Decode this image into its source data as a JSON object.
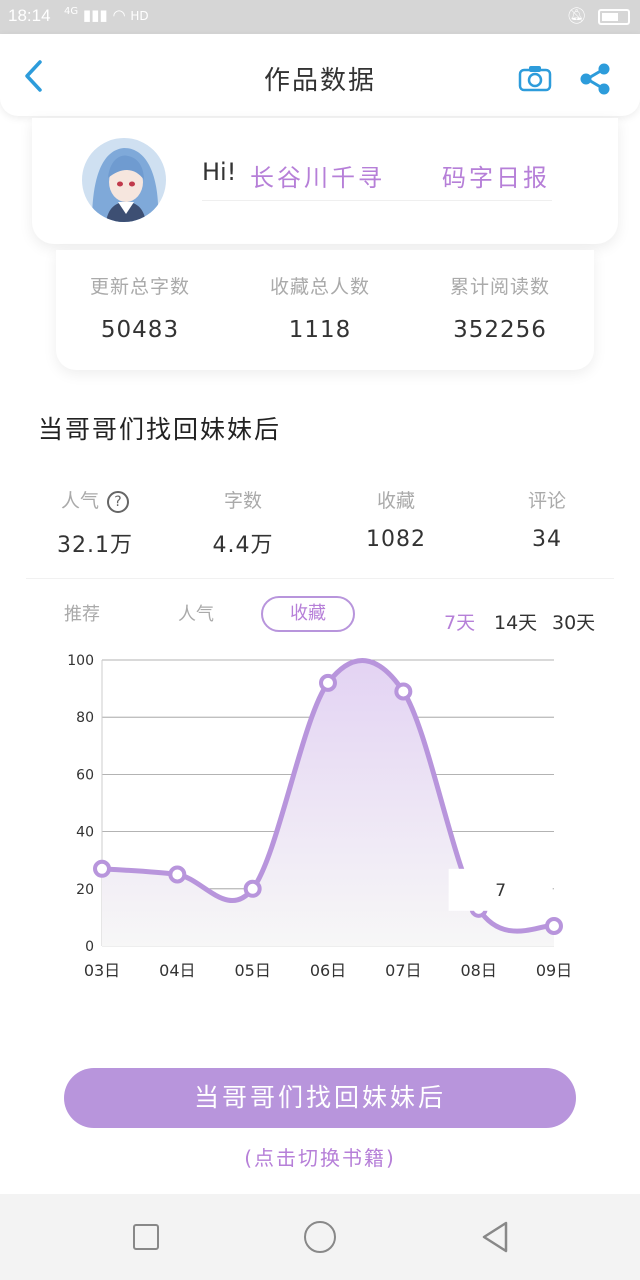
{
  "status_bar": {
    "time": "18:14",
    "network": "4G",
    "hd": "HD"
  },
  "header": {
    "title": "作品数据",
    "back_icon": "back-chevron-icon",
    "camera_icon": "camera-icon",
    "share_icon": "share-icon"
  },
  "profile": {
    "greeting": "Hi!",
    "author_name": "长谷川千寻",
    "daily_report": "码字日报"
  },
  "totals": [
    {
      "label": "更新总字数",
      "value": "50483"
    },
    {
      "label": "收藏总人数",
      "value": "1118"
    },
    {
      "label": "累计阅读数",
      "value": "352256"
    }
  ],
  "book": {
    "title": "当哥哥们找回妹妹后"
  },
  "metrics": [
    {
      "label": "人气",
      "value": "32.1万",
      "help": "?"
    },
    {
      "label": "字数",
      "value": "4.4万"
    },
    {
      "label": "收藏",
      "value": "1082"
    },
    {
      "label": "评论",
      "value": "34"
    }
  ],
  "tabs": [
    {
      "label": "推荐",
      "active": false
    },
    {
      "label": "人气",
      "active": false
    },
    {
      "label": "收藏",
      "active": true
    }
  ],
  "ranges": [
    {
      "label": "7天",
      "active": true
    },
    {
      "label": "14天",
      "active": false
    },
    {
      "label": "30天",
      "active": false
    }
  ],
  "chart_data": {
    "type": "area",
    "categories": [
      "03日",
      "04日",
      "05日",
      "06日",
      "07日",
      "08日",
      "09日"
    ],
    "series": [
      {
        "values": [
          27,
          25,
          20,
          92,
          89,
          13,
          7
        ]
      }
    ],
    "ylim": [
      0,
      100
    ],
    "yticks": [
      0,
      20,
      40,
      60,
      80,
      100
    ],
    "tooltip": "7",
    "colors": {
      "line": "#b895dc",
      "fill_top": "#e3d3f3",
      "fill_bottom": "#f7f7f7"
    }
  },
  "footer": {
    "switch_button": "当哥哥们找回妹妹后",
    "switch_hint": "(点击切换书籍)"
  },
  "colors": {
    "accent": "#b67fd8",
    "button": "#b895dc",
    "icon_blue": "#2d9cdb"
  }
}
